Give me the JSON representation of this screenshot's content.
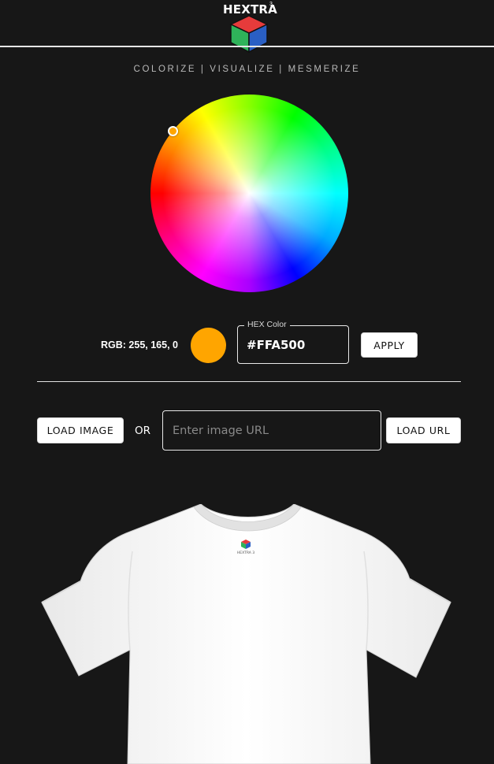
{
  "header": {
    "logo_text": "HEXTRA",
    "logo_sup": "3",
    "tagline": "COLORIZE | VISUALIZE | MESMERIZE"
  },
  "color_picker": {
    "rgb_label": "RGB: 255, 165, 0",
    "swatch_color": "#FFA500",
    "hex_legend": "HEX Color",
    "hex_value": "#FFA500",
    "apply_label": "APPLY"
  },
  "image_loader": {
    "load_image_label": "LOAD IMAGE",
    "or_label": "OR",
    "url_placeholder": "Enter image URL",
    "url_value": "",
    "load_url_label": "LOAD URL"
  },
  "preview": {
    "shirt_color": "#FFFFFF",
    "tag_text": "HEXTRA 3"
  },
  "colors": {
    "background": "#171717",
    "accent": "#FFA500"
  }
}
